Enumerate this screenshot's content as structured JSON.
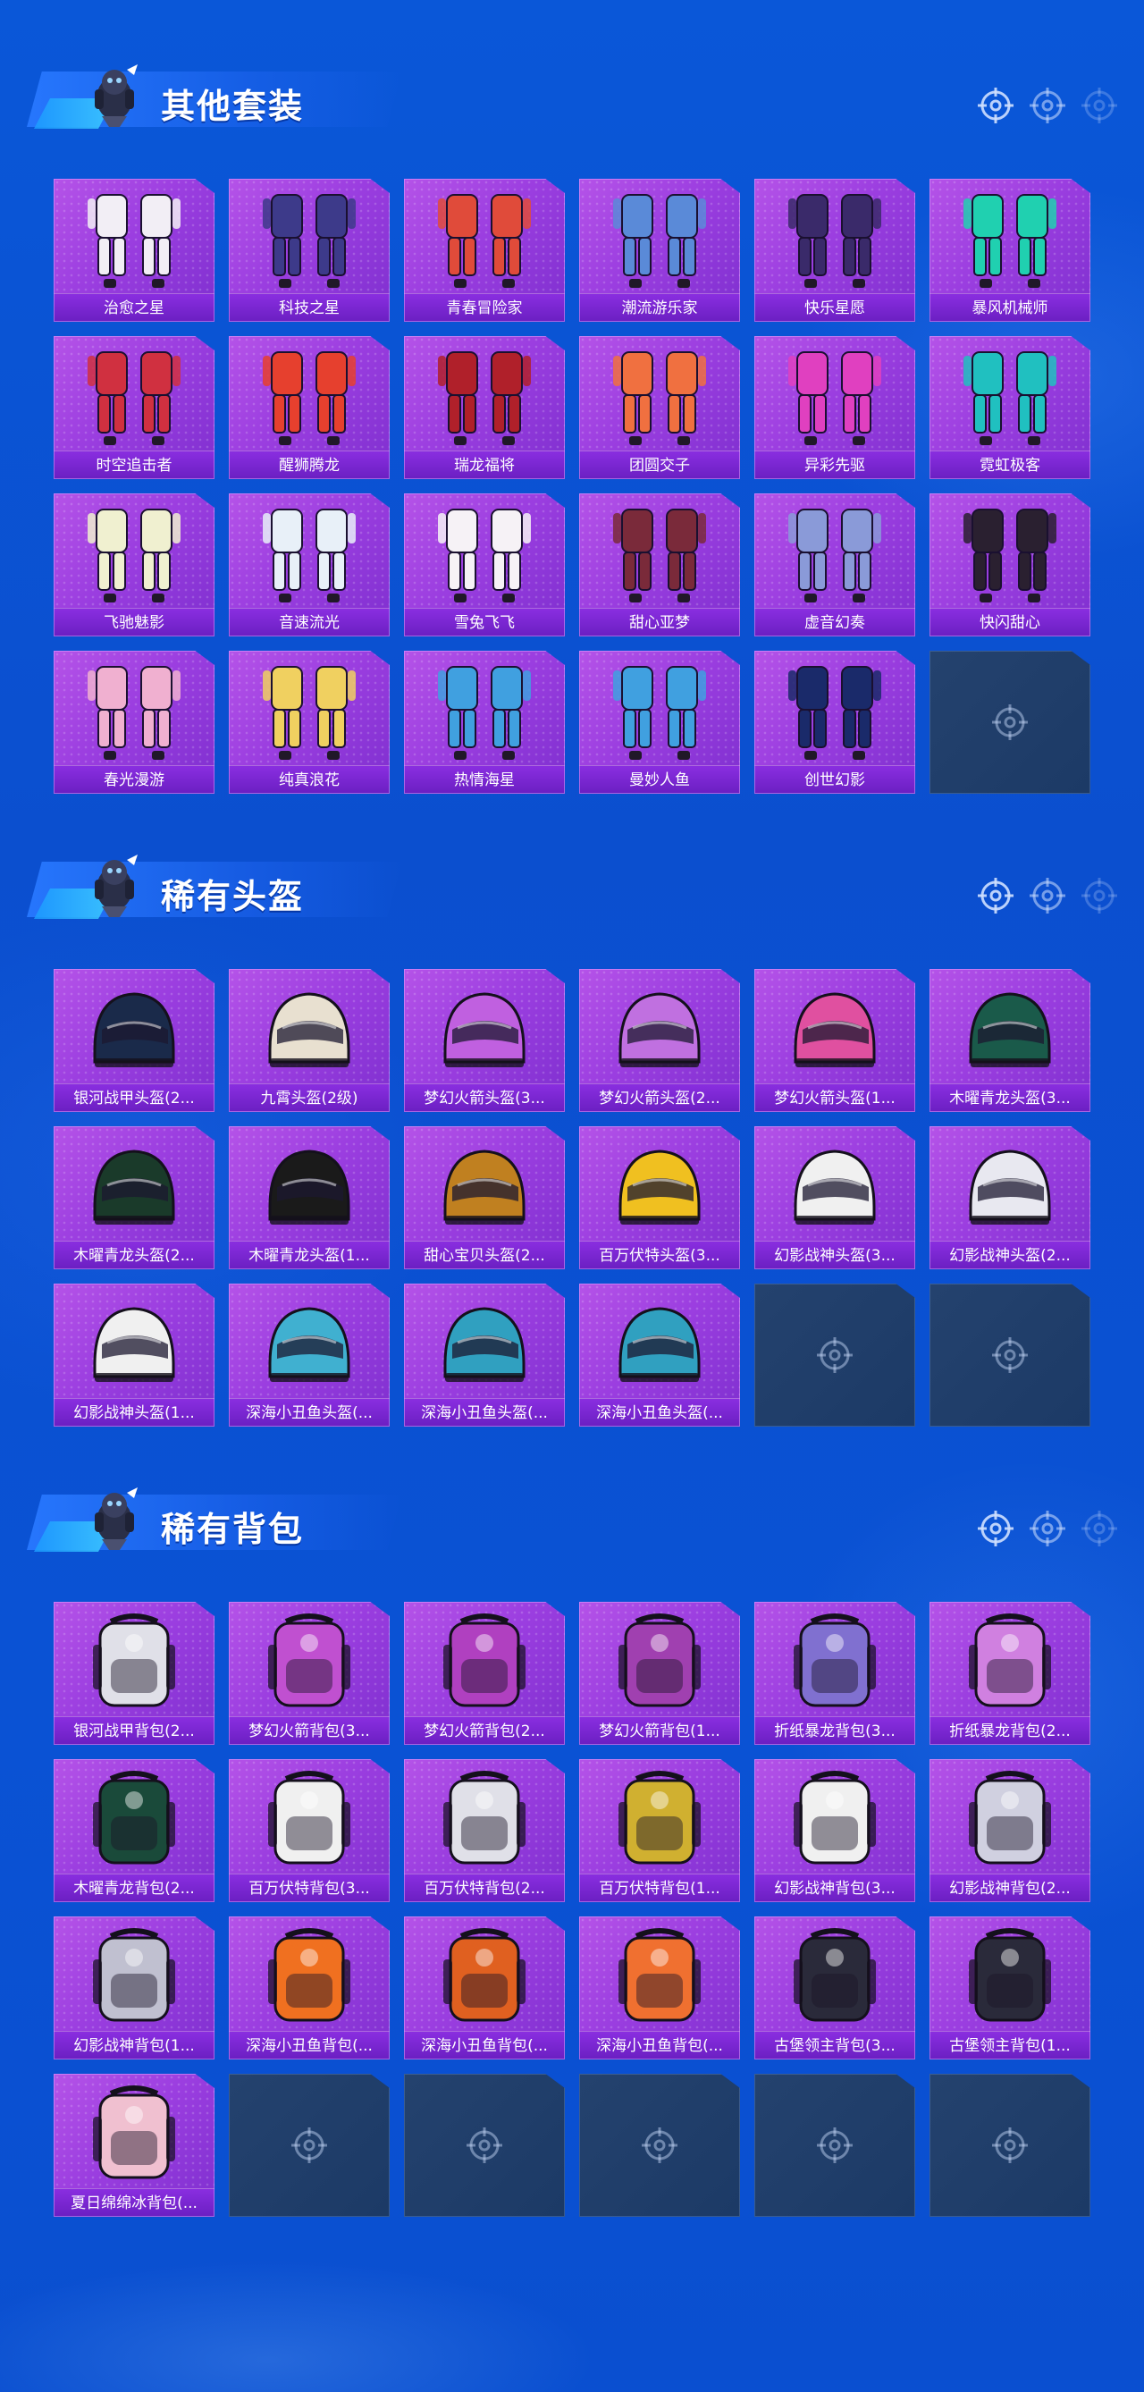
{
  "colors": {
    "background": "#0a55d6",
    "card_purple": "#9b3ee0",
    "label_bar": "#7a26d2",
    "empty_slot": "#203e6a",
    "icon_glyph": "#cfe0ff"
  },
  "sections": [
    {
      "title": "其他套装",
      "items": [
        {
          "label": "治愈之星",
          "accent": "#f2eef5"
        },
        {
          "label": "科技之星",
          "accent": "#3d3a8a"
        },
        {
          "label": "青春冒险家",
          "accent": "#e04b3a"
        },
        {
          "label": "潮流游乐家",
          "accent": "#5a8ad8"
        },
        {
          "label": "快乐星愿",
          "accent": "#3a2a6a"
        },
        {
          "label": "暴风机械师",
          "accent": "#20d0b0"
        },
        {
          "label": "时空追击者",
          "accent": "#d03040"
        },
        {
          "label": "醒狮腾龙",
          "accent": "#e6402e"
        },
        {
          "label": "瑞龙福将",
          "accent": "#b0202a"
        },
        {
          "label": "团圆交子",
          "accent": "#f07040"
        },
        {
          "label": "异彩先驱",
          "accent": "#e040c0"
        },
        {
          "label": "霓虹极客",
          "accent": "#20c0c0"
        },
        {
          "label": "飞驰魅影",
          "accent": "#f0f0d0"
        },
        {
          "label": "音速流光",
          "accent": "#e8f0f8"
        },
        {
          "label": "雪兔飞飞",
          "accent": "#f6f2f6"
        },
        {
          "label": "甜心亚梦",
          "accent": "#7a2a3a"
        },
        {
          "label": "虚音幻奏",
          "accent": "#8a9ad8"
        },
        {
          "label": "快闪甜心",
          "accent": "#2a2030"
        },
        {
          "label": "春光漫游",
          "accent": "#f0b0d0"
        },
        {
          "label": "纯真浪花",
          "accent": "#f0d060"
        },
        {
          "label": "热情海星",
          "accent": "#40a0e0"
        },
        {
          "label": "曼妙人鱼",
          "accent": "#40a0e0"
        },
        {
          "label": "创世幻影",
          "accent": "#1a2a6a"
        },
        {
          "label": "",
          "accent": ""
        }
      ]
    },
    {
      "title": "稀有头盔",
      "items": [
        {
          "label": "银河战甲头盔(2...",
          "accent": "#1a2a4a"
        },
        {
          "label": "九霄头盔(2级)",
          "accent": "#e8e0d0"
        },
        {
          "label": "梦幻火箭头盔(3...",
          "accent": "#c060e0"
        },
        {
          "label": "梦幻火箭头盔(2...",
          "accent": "#c070e0"
        },
        {
          "label": "梦幻火箭头盔(1...",
          "accent": "#e050a0"
        },
        {
          "label": "木曜青龙头盔(3...",
          "accent": "#1a5a4a"
        },
        {
          "label": "木曜青龙头盔(2...",
          "accent": "#1a3a2a"
        },
        {
          "label": "木曜青龙头盔(1...",
          "accent": "#1a1a1a"
        },
        {
          "label": "甜心宝贝头盔(2...",
          "accent": "#c08020"
        },
        {
          "label": "百万伏特头盔(3...",
          "accent": "#f0c020"
        },
        {
          "label": "幻影战神头盔(3...",
          "accent": "#f0f0f0"
        },
        {
          "label": "幻影战神头盔(2...",
          "accent": "#e8e8f0"
        },
        {
          "label": "幻影战神头盔(1...",
          "accent": "#f0f0f0"
        },
        {
          "label": "深海小丑鱼头盔(...",
          "accent": "#40b0d0"
        },
        {
          "label": "深海小丑鱼头盔(...",
          "accent": "#30a0c0"
        },
        {
          "label": "深海小丑鱼头盔(...",
          "accent": "#30a0c0"
        },
        {
          "label": "",
          "accent": ""
        },
        {
          "label": "",
          "accent": ""
        }
      ]
    },
    {
      "title": "稀有背包",
      "items": [
        {
          "label": "银河战甲背包(2...",
          "accent": "#e0e0e8"
        },
        {
          "label": "梦幻火箭背包(3...",
          "accent": "#c050d0"
        },
        {
          "label": "梦幻火箭背包(2...",
          "accent": "#b040c0"
        },
        {
          "label": "梦幻火箭背包(1...",
          "accent": "#a040b0"
        },
        {
          "label": "折纸暴龙背包(3...",
          "accent": "#8070d0"
        },
        {
          "label": "折纸暴龙背包(2...",
          "accent": "#d080e0"
        },
        {
          "label": "木曜青龙背包(2...",
          "accent": "#1a4a3a"
        },
        {
          "label": "百万伏特背包(3...",
          "accent": "#f0f0f0"
        },
        {
          "label": "百万伏特背包(2...",
          "accent": "#e0e0e8"
        },
        {
          "label": "百万伏特背包(1...",
          "accent": "#d0b030"
        },
        {
          "label": "幻影战神背包(3...",
          "accent": "#f0f0f0"
        },
        {
          "label": "幻影战神背包(2...",
          "accent": "#d0d0e0"
        },
        {
          "label": "幻影战神背包(1...",
          "accent": "#c0c0d0"
        },
        {
          "label": "深海小丑鱼背包(...",
          "accent": "#f07020"
        },
        {
          "label": "深海小丑鱼背包(...",
          "accent": "#e06020"
        },
        {
          "label": "深海小丑鱼背包(...",
          "accent": "#f07030"
        },
        {
          "label": "古堡领主背包(3...",
          "accent": "#2a2a3a"
        },
        {
          "label": "古堡领主背包(1...",
          "accent": "#2a2a3a"
        },
        {
          "label": "夏日绵绵冰背包(...",
          "accent": "#f0c0d0"
        },
        {
          "label": "",
          "accent": ""
        },
        {
          "label": "",
          "accent": ""
        },
        {
          "label": "",
          "accent": ""
        },
        {
          "label": "",
          "accent": ""
        },
        {
          "label": "",
          "accent": ""
        }
      ]
    }
  ]
}
